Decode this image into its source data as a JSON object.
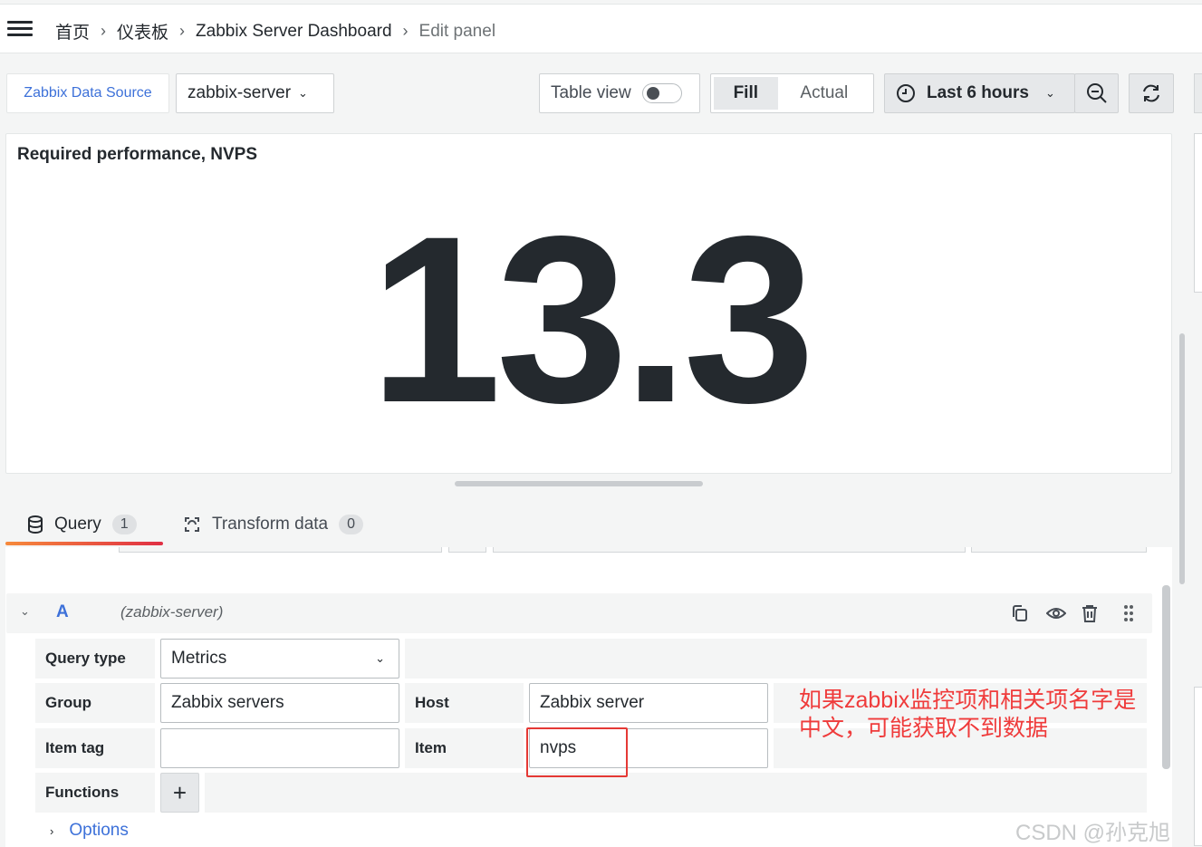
{
  "breadcrumb": [
    "首页",
    "仪表板",
    "Zabbix Server Dashboard",
    "Edit panel"
  ],
  "toolbar": {
    "datasource_link": "Zabbix Data Source",
    "datasource_select": "zabbix-server",
    "table_view_label": "Table view",
    "table_view_on": false,
    "fill_label": "Fill",
    "actual_label": "Actual",
    "time_range": "Last 6 hours"
  },
  "panel": {
    "title": "Required performance, NVPS",
    "value": "13.3"
  },
  "tabs": [
    {
      "label": "Query",
      "count": "1"
    },
    {
      "label": "Transform data",
      "count": "0"
    }
  ],
  "query": {
    "ref_id": "A",
    "datasource_name": "(zabbix-server)",
    "query_type_label": "Query type",
    "query_type_value": "Metrics",
    "group_label": "Group",
    "group_value": "Zabbix servers",
    "host_label": "Host",
    "host_value": "Zabbix server",
    "item_tag_label": "Item tag",
    "item_tag_value": "",
    "item_label": "Item",
    "item_value": "nvps",
    "functions_label": "Functions",
    "add_function_label": "+",
    "options_label": "Options"
  },
  "annotation": "如果zabbix监控项和相关项名字是中文，可能获取不到数据",
  "watermark": "CSDN @孙克旭",
  "colors": {
    "accent": "#3d71d9",
    "annotation": "#ef3b3b",
    "tab_underline": "#f68a3c"
  }
}
